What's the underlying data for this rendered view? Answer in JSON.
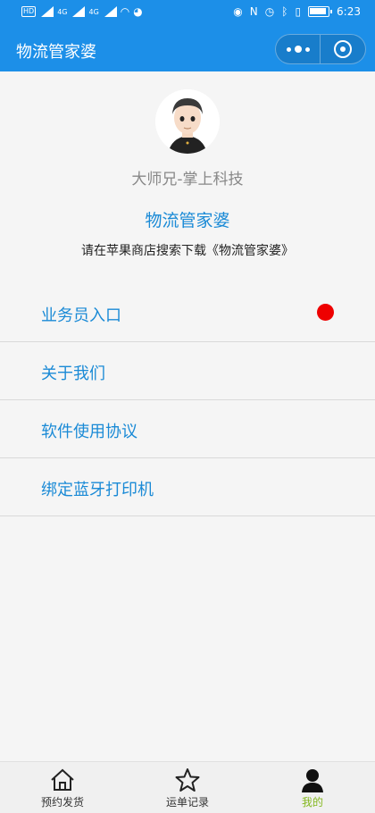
{
  "status_bar": {
    "time": "6:23",
    "network_left": "4G",
    "network_right": "4G"
  },
  "header": {
    "title": "物流管家婆"
  },
  "profile": {
    "username": "大师兄-掌上科技",
    "app_name": "物流管家婆",
    "download_tip": "请在苹果商店搜索下载《物流管家婆》"
  },
  "menu": [
    {
      "label": "业务员入口",
      "badge": true
    },
    {
      "label": "关于我们"
    },
    {
      "label": "软件使用协议"
    },
    {
      "label": "绑定蓝牙打印机"
    }
  ],
  "tabbar": {
    "tabs": [
      {
        "label": "预约发货",
        "icon": "home-icon"
      },
      {
        "label": "运单记录",
        "icon": "star-icon"
      },
      {
        "label": "我的",
        "icon": "person-icon",
        "active": true
      }
    ]
  },
  "colors": {
    "header_bg": "#1c8fe8",
    "link": "#1a8ad6",
    "active_tab": "#84b81f",
    "badge": "#ee0000"
  }
}
